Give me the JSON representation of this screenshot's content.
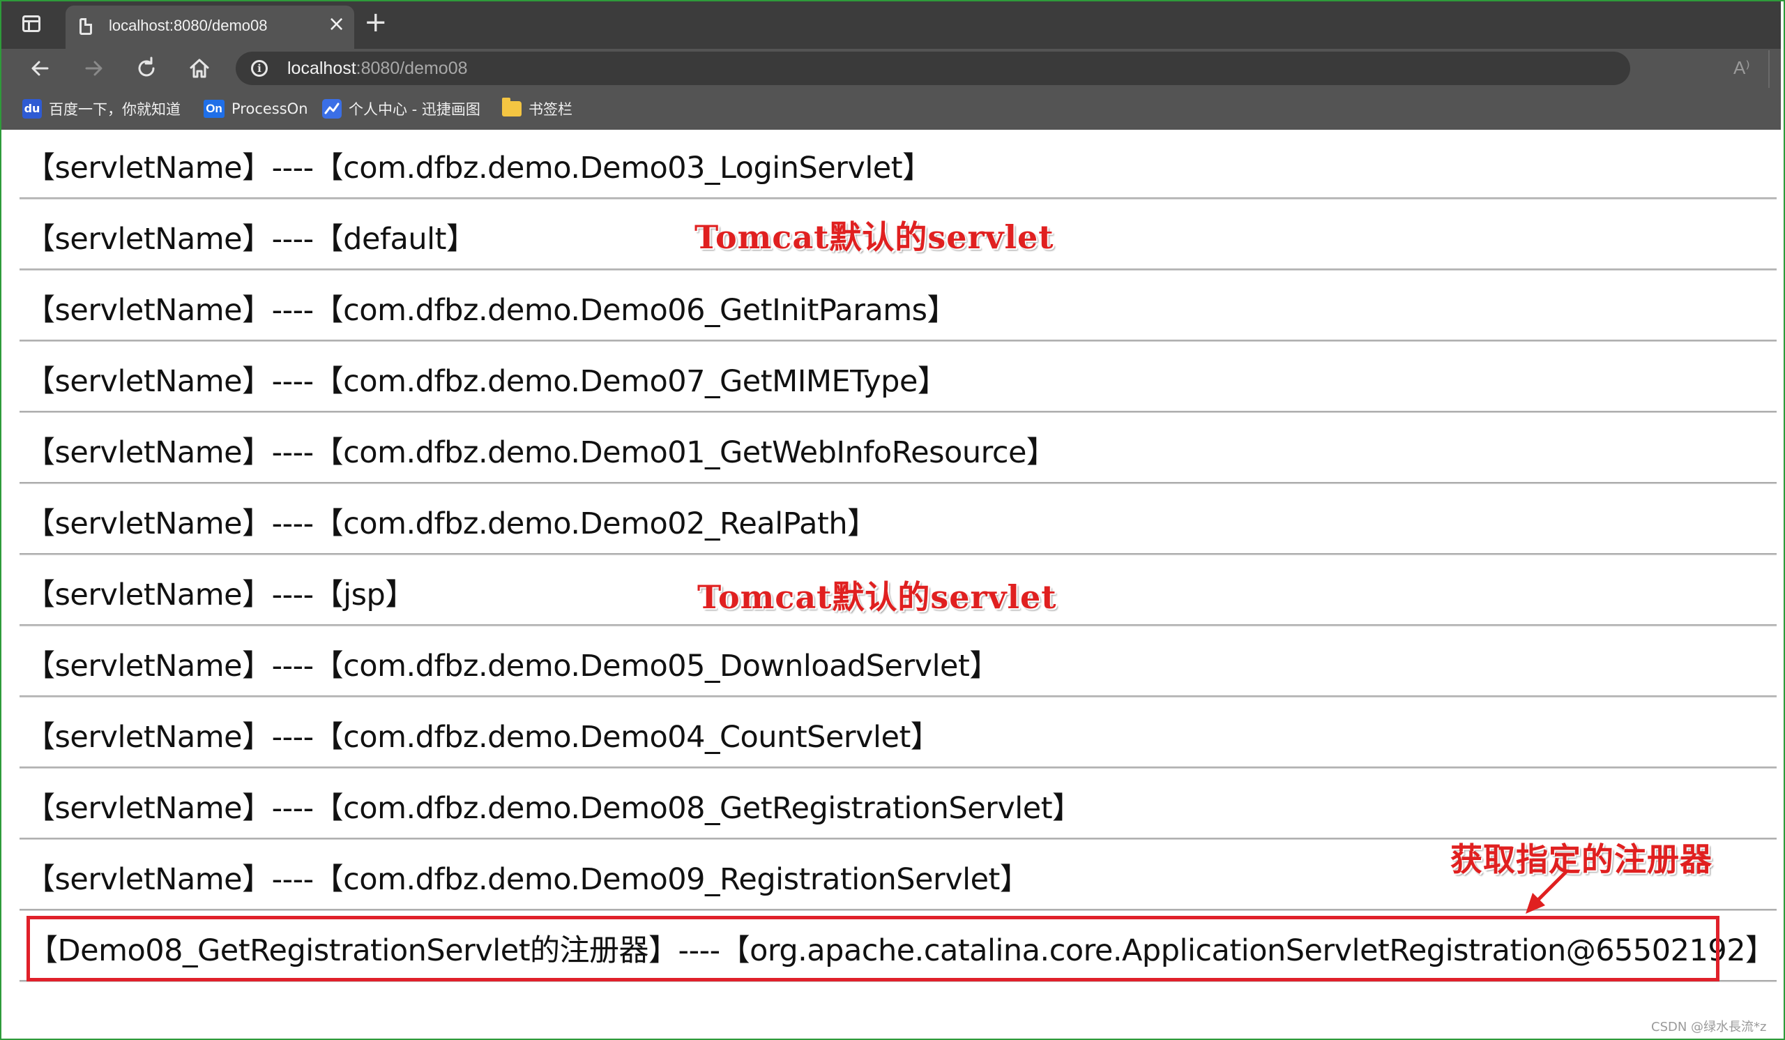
{
  "browser": {
    "tab_title": "localhost:8080/demo08",
    "tab_close": "×",
    "new_tab": "+",
    "url_host": "localhost",
    "url_rest": ":8080/demo08",
    "read_aloud": "A⁾",
    "bookmarks": [
      {
        "icon": "baidu-icon",
        "label": "百度一下，你就知道"
      },
      {
        "icon": "processon-icon",
        "icon_text": "On",
        "label": "ProcessOn"
      },
      {
        "icon": "xunjie-icon",
        "label": "个人中心 - 迅捷画图"
      },
      {
        "icon": "folder-icon",
        "label": "书签栏"
      }
    ]
  },
  "page": {
    "rows": [
      "【servletName】----【com.dfbz.demo.Demo03_LoginServlet】",
      "【servletName】----【default】",
      "【servletName】----【com.dfbz.demo.Demo06_GetInitParams】",
      "【servletName】----【com.dfbz.demo.Demo07_GetMIMEType】",
      "【servletName】----【com.dfbz.demo.Demo01_GetWebInfoResource】",
      "【servletName】----【com.dfbz.demo.Demo02_RealPath】",
      "【servletName】----【jsp】",
      "【servletName】----【com.dfbz.demo.Demo05_DownloadServlet】",
      "【servletName】----【com.dfbz.demo.Demo04_CountServlet】",
      "【servletName】----【com.dfbz.demo.Demo08_GetRegistrationServlet】",
      "【servletName】----【com.dfbz.demo.Demo09_RegistrationServlet】",
      "【Demo08_GetRegistrationServlet的注册器】----【org.apache.catalina.core.ApplicationServletRegistration@65502192】"
    ]
  },
  "annotations": {
    "default_note": "Tomcat默认的servlet",
    "jsp_note": "Tomcat默认的servlet",
    "registration_note": "获取指定的注册器",
    "color": "#e02020"
  },
  "watermark": "CSDN @绿水長流*z"
}
